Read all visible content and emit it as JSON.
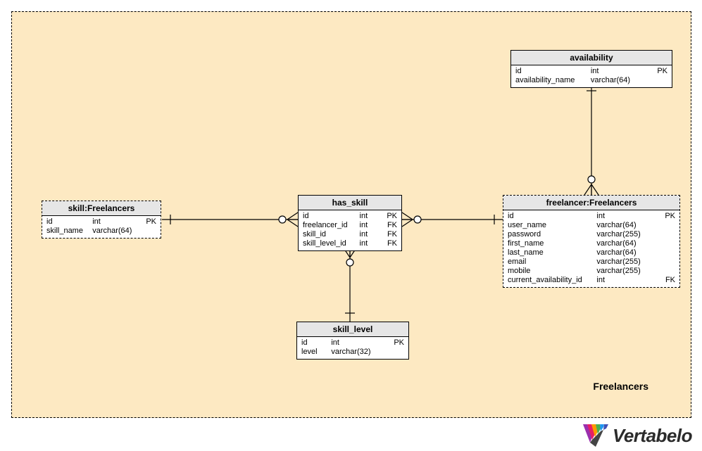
{
  "region_label": "Freelancers",
  "logo_text": "Vertabelo",
  "entities": {
    "availability": {
      "title": "availability",
      "rows": [
        {
          "name": "id",
          "type": "int",
          "mark": "PK"
        },
        {
          "name": "availability_name",
          "type": "varchar(64)",
          "mark": ""
        }
      ]
    },
    "freelancer": {
      "title": "freelancer:Freelancers",
      "rows": [
        {
          "name": "id",
          "type": "int",
          "mark": "PK"
        },
        {
          "name": "user_name",
          "type": "varchar(64)",
          "mark": ""
        },
        {
          "name": "password",
          "type": "varchar(255)",
          "mark": ""
        },
        {
          "name": "first_name",
          "type": "varchar(64)",
          "mark": ""
        },
        {
          "name": "last_name",
          "type": "varchar(64)",
          "mark": ""
        },
        {
          "name": "email",
          "type": "varchar(255)",
          "mark": ""
        },
        {
          "name": "mobile",
          "type": "varchar(255)",
          "mark": ""
        },
        {
          "name": "current_availability_id",
          "type": "int",
          "mark": "FK"
        }
      ]
    },
    "has_skill": {
      "title": "has_skill",
      "rows": [
        {
          "name": "id",
          "type": "int",
          "mark": "PK"
        },
        {
          "name": "freelancer_id",
          "type": "int",
          "mark": "FK"
        },
        {
          "name": "skill_id",
          "type": "int",
          "mark": "FK"
        },
        {
          "name": "skill_level_id",
          "type": "int",
          "mark": "FK"
        }
      ]
    },
    "skill": {
      "title": "skill:Freelancers",
      "rows": [
        {
          "name": "id",
          "type": "int",
          "mark": "PK"
        },
        {
          "name": "skill_name",
          "type": "varchar(64)",
          "mark": ""
        }
      ]
    },
    "skill_level": {
      "title": "skill_level",
      "rows": [
        {
          "name": "id",
          "type": "int",
          "mark": "PK"
        },
        {
          "name": "level",
          "type": "varchar(32)",
          "mark": ""
        }
      ]
    }
  }
}
